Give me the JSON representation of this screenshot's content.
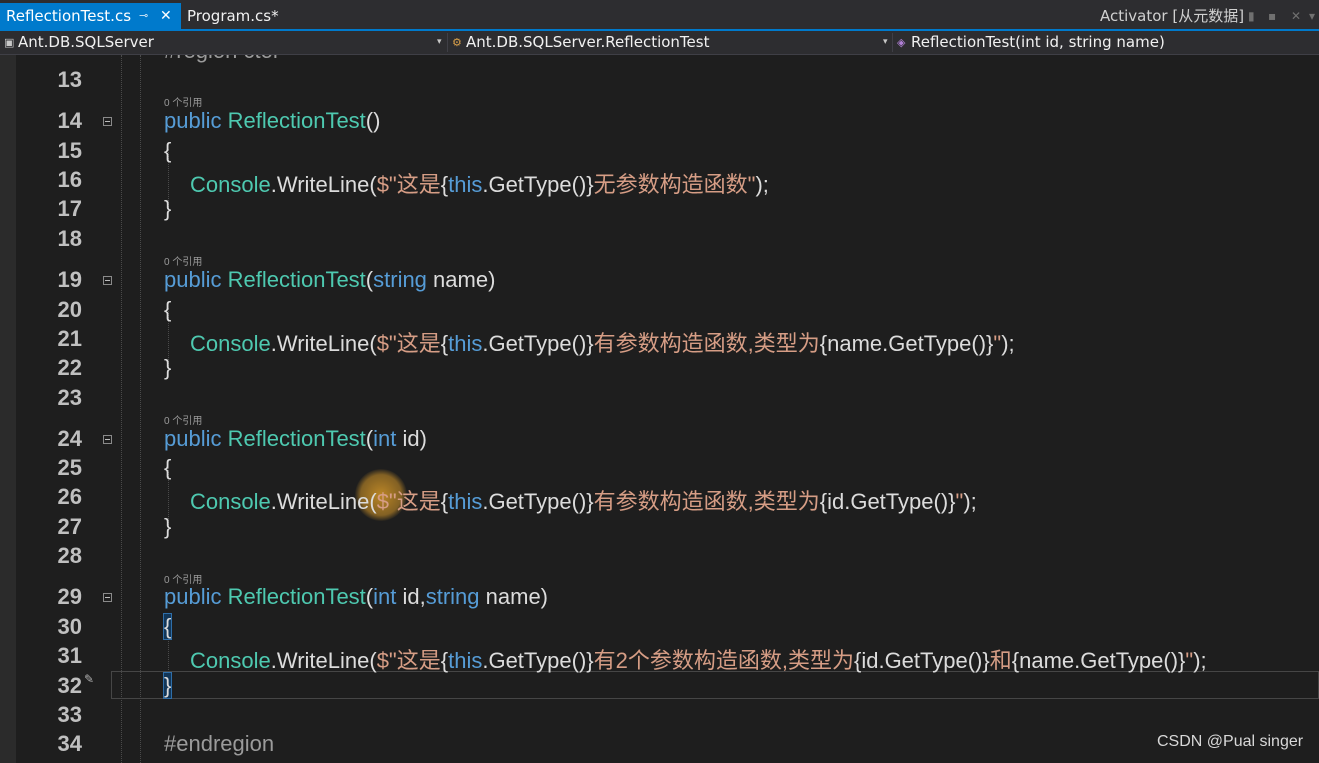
{
  "tabs": {
    "active_label": "ReflectionTest.cs",
    "pin_glyph": "⊸",
    "close_glyph": "✕",
    "second_label": "Program.cs*",
    "activator": "Activator [从元数据]"
  },
  "window": {
    "pin_glyph": "▮",
    "dock_glyph": "▪",
    "close_glyph": "✕",
    "menu_glyph": "▾"
  },
  "navbar": {
    "project": "Ant.DB.SQLServer",
    "type": "Ant.DB.SQLServer.ReflectionTest",
    "member": "ReflectionTest(int id, string name)",
    "arrow": "▾"
  },
  "lens_text": "0 个引用",
  "line_numbers": {
    "l13": "13",
    "l14": "14",
    "l15": "15",
    "l16": "16",
    "l17": "17",
    "l18": "18",
    "l19": "19",
    "l20": "20",
    "l21": "21",
    "l22": "22",
    "l23": "23",
    "l24": "24",
    "l25": "25",
    "l26": "26",
    "l27": "27",
    "l28": "28",
    "l29": "29",
    "l30": "30",
    "l31": "31",
    "l32": "32",
    "l33": "33",
    "l34": "34"
  },
  "code": {
    "l12": "#region ctor",
    "ctor1": {
      "kw": "public",
      "name": "ReflectionTest",
      "rest": "()"
    },
    "ctor2": {
      "kw": "public",
      "name": "ReflectionTest",
      "p1": "(",
      "t1": "string",
      "rest": " name)"
    },
    "ctor3": {
      "kw": "public",
      "name": "ReflectionTest",
      "p1": "(",
      "t1": "int",
      "rest": " id)"
    },
    "ctor4": {
      "kw": "public",
      "name": "ReflectionTest",
      "p1": "(",
      "t1": "int",
      "mid": " id,",
      "t2": "string",
      "rest": " name)"
    },
    "open_brace": "{",
    "close_brace": "}",
    "console": "Console",
    "writeline": ".WriteLine(",
    "this_kw": "this",
    "gettype": ".GetType()",
    "str_open": "$\"这是",
    "open_interp": "{",
    "close_interp": "}",
    "w1_str": "无参数构造函数\"",
    "w1_end": ");",
    "w2_str": "有参数构造函数,类型为",
    "w2_interp": "{name.GetType()}",
    "w2_end_str": "\"",
    "w2_end": ");",
    "w3_str": "有参数构造函数,类型为",
    "w3_interp": "{id.GetType()}",
    "w3_end_str": "\"",
    "w3_end": ");",
    "w4_str": "有2个参数构造函数,类型为",
    "w4_interp1": "{id.GetType()}",
    "w4_and": "和",
    "w4_interp2": "{name.GetType()}",
    "w4_end_str": "\"",
    "w4_end": ");",
    "endregion": "#endregion"
  },
  "watermark": "CSDN @Pual singer",
  "colors": {
    "keyword": "#569cd6",
    "type": "#4ec9b0",
    "string": "#d69d85",
    "text": "#dcdcdc",
    "accent": "#007acc",
    "background": "#1e1e1e"
  }
}
